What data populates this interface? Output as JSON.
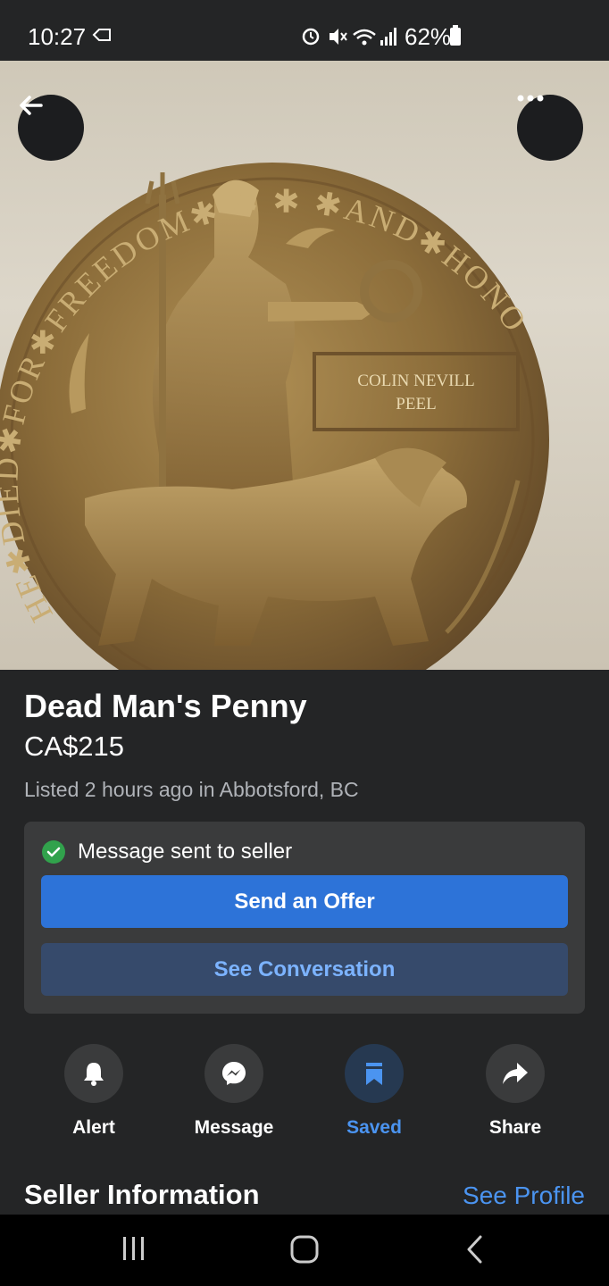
{
  "status_bar": {
    "time": "10:27",
    "battery": "62%"
  },
  "photo": {
    "alt": "Bronze memorial plaque",
    "inscription_name_line1": "COLIN NEVILL",
    "inscription_name_line2": "PEEL"
  },
  "listing": {
    "title": "Dead Man's Penny",
    "price": "CA$215",
    "listed": "Listed 2 hours ago in Abbotsford, BC"
  },
  "message_panel": {
    "status": "Message sent to seller",
    "offer_label": "Send an Offer",
    "conversation_label": "See Conversation"
  },
  "actions": [
    {
      "label": "Alert",
      "icon": "bell-icon",
      "active": false
    },
    {
      "label": "Message",
      "icon": "messenger-icon",
      "active": false
    },
    {
      "label": "Saved",
      "icon": "bookmark-icon",
      "active": true
    },
    {
      "label": "Share",
      "icon": "share-icon",
      "active": false
    }
  ],
  "seller": {
    "heading": "Seller Information",
    "see_profile": "See Profile"
  },
  "colors": {
    "background": "#242526",
    "accent": "#2d73d8",
    "link": "#4b94f0",
    "success": "#31a24c"
  }
}
